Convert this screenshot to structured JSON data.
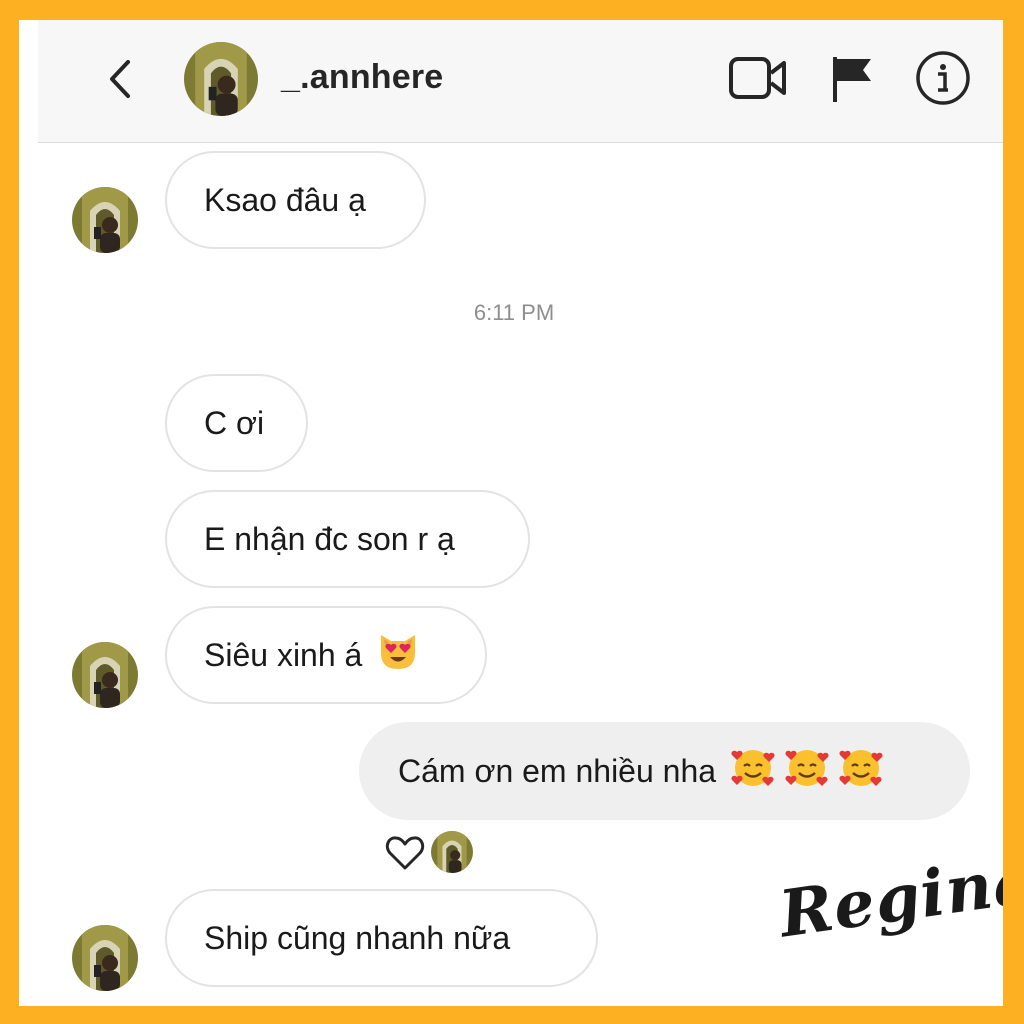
{
  "header": {
    "username": "_.annhere"
  },
  "messages": [
    {
      "text": "Ksao đâu ạ"
    },
    {
      "text": "C ơi"
    },
    {
      "text": "E nhận đc son r ạ"
    },
    {
      "text": "Siêu xinh á"
    },
    {
      "text": "Cám ơn em nhiều nha"
    },
    {
      "text": "Ship cũng nhanh nữa"
    }
  ],
  "timestamp": "6:11 PM",
  "watermark": "Regina",
  "colors": {
    "frame": "#FDB022",
    "incoming_border": "#e3e3e3",
    "outgoing_bg": "#efefef"
  },
  "icons": [
    "back-arrow-icon",
    "video-call-icon",
    "flag-icon",
    "info-icon",
    "heart-icon",
    "heart-eyes-cat-emoji",
    "smiling-face-with-hearts-emoji"
  ]
}
